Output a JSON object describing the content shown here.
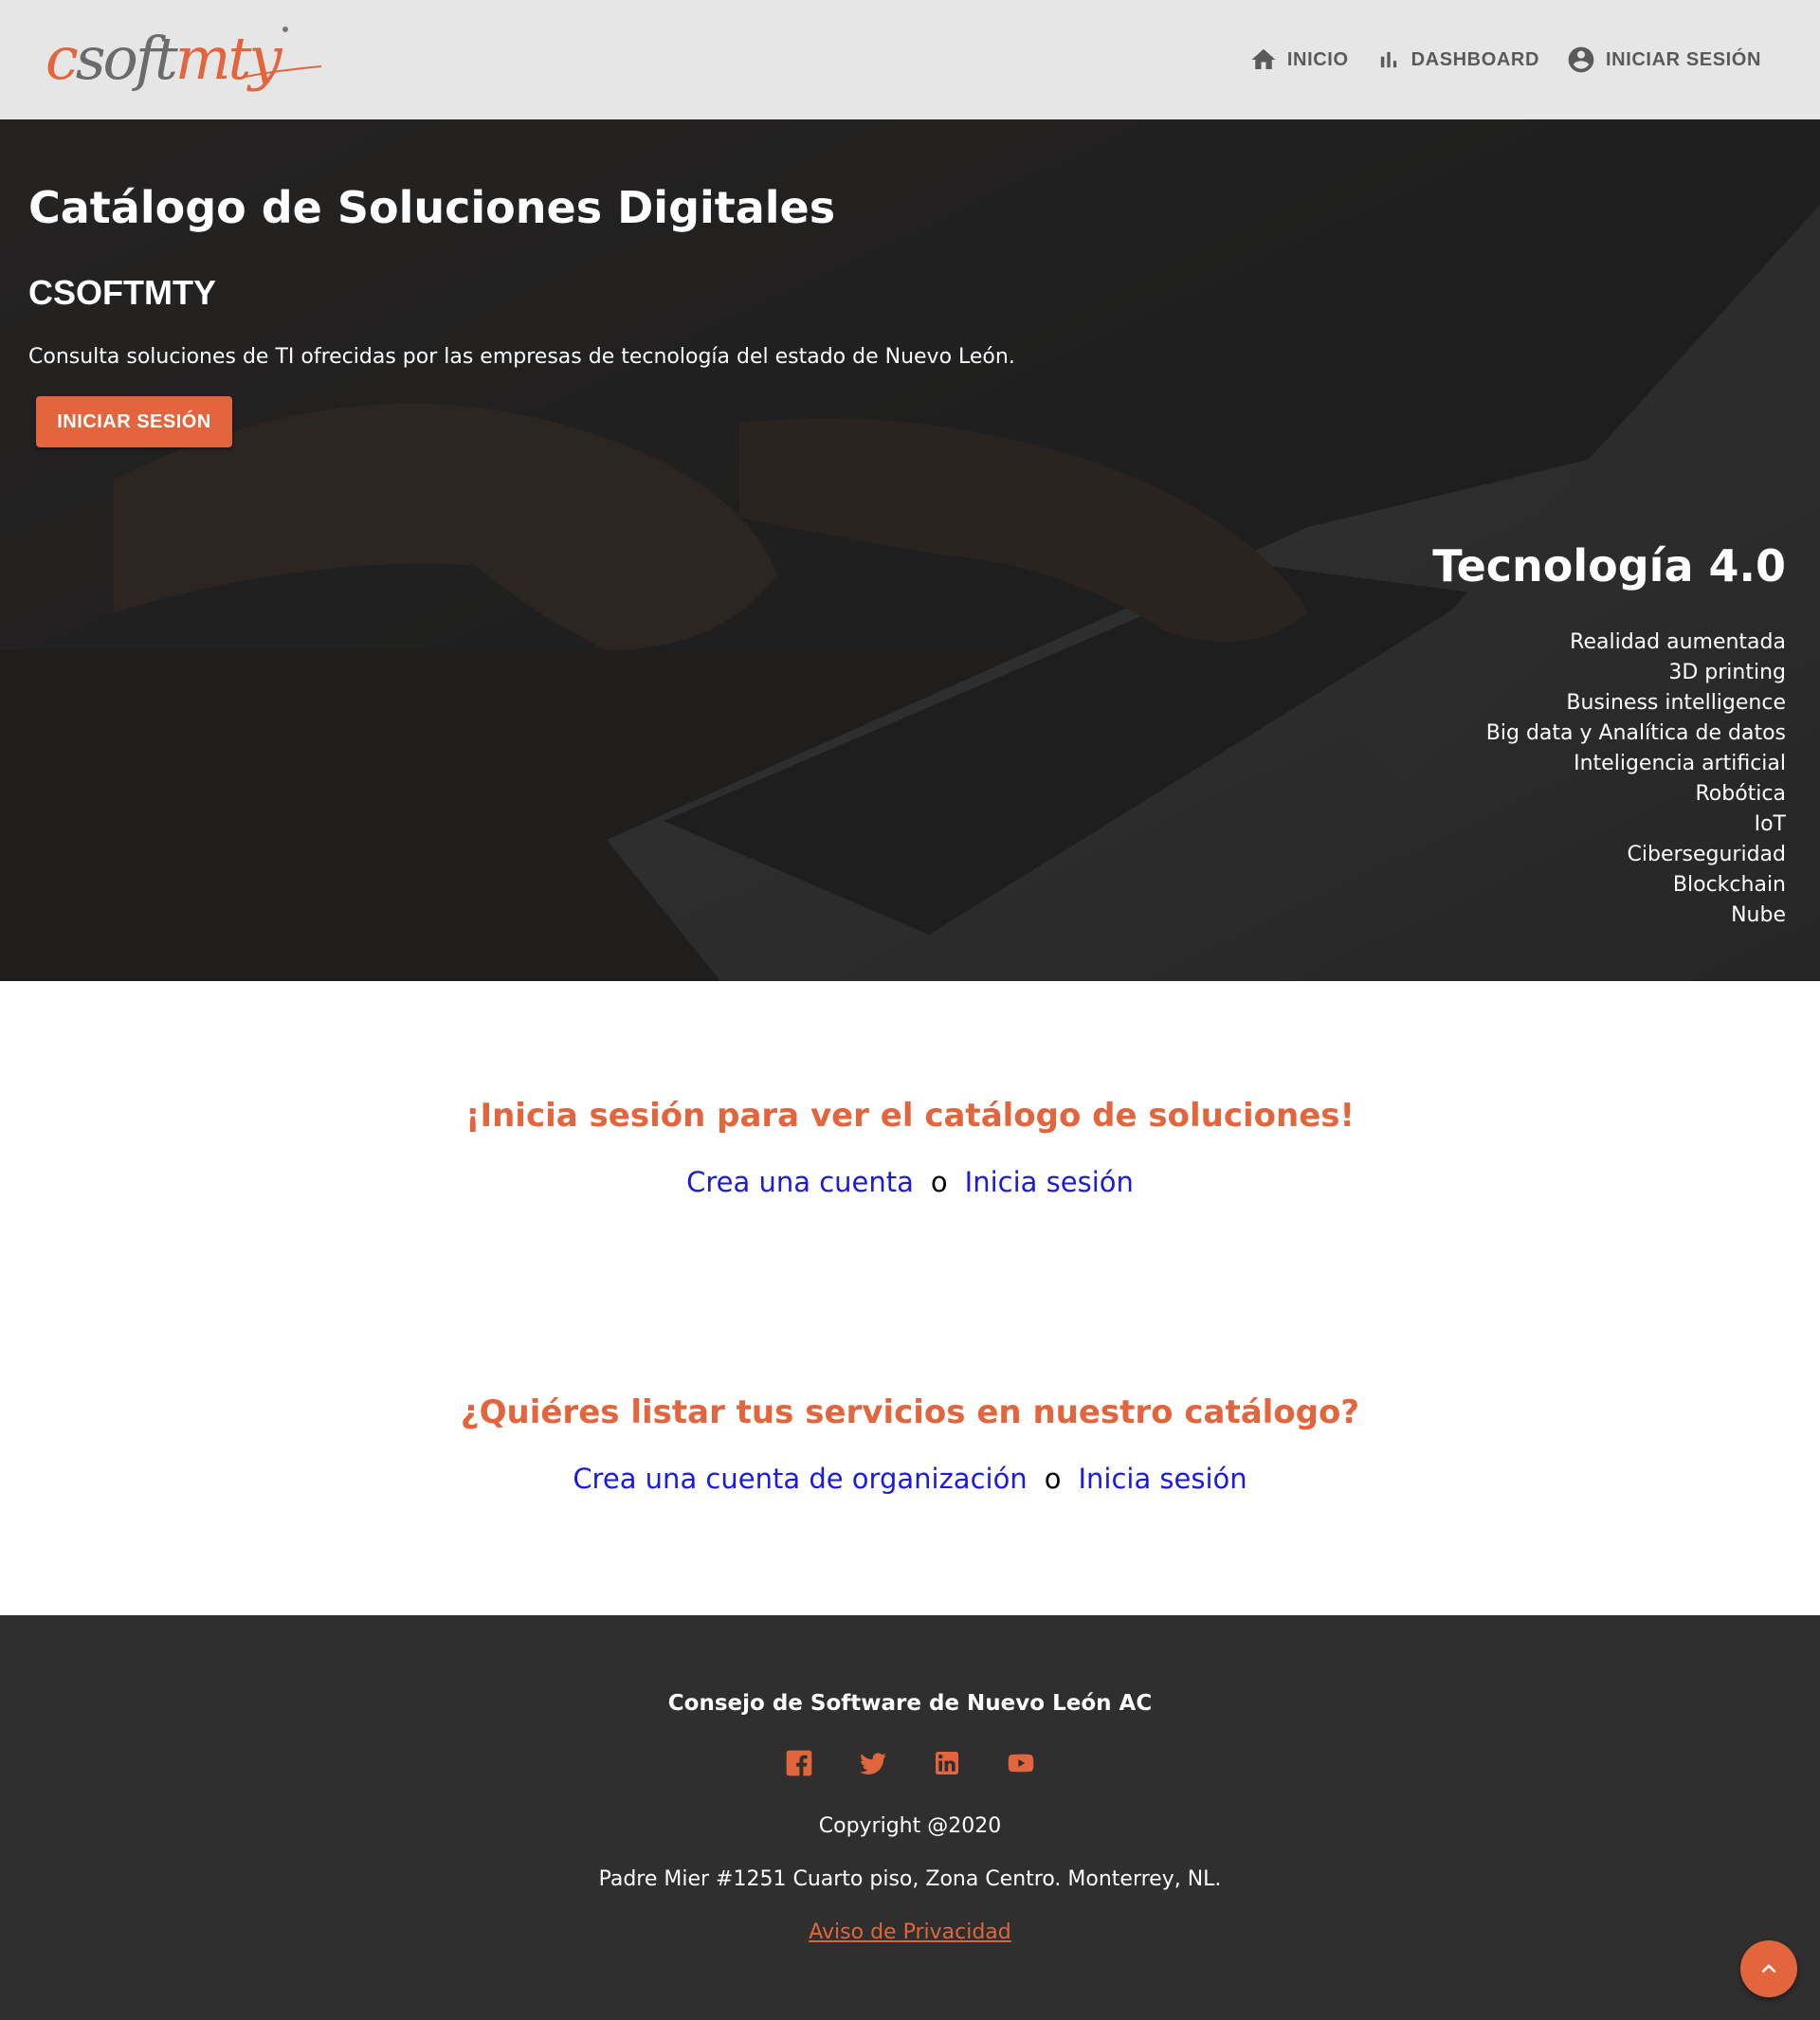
{
  "header": {
    "logo": "csoftmty",
    "nav": [
      {
        "label": "INICIO",
        "icon": "home-icon"
      },
      {
        "label": "DASHBOARD",
        "icon": "bar-chart-icon"
      },
      {
        "label": "INICIAR SESIÓN",
        "icon": "account-circle-icon"
      }
    ]
  },
  "hero": {
    "title": "Catálogo de Soluciones Digitales",
    "subtitle": "CSOFTMTY",
    "description": "Consulta soluciones de TI ofrecidas por las empresas de tecnología del estado de Nuevo León.",
    "button_label": "INICIAR SESIÓN",
    "tech_title": "Tecnología 4.0",
    "tech_items": [
      "Realidad aumentada",
      "3D printing",
      "Business intelligence",
      "Big data y Analítica de datos",
      "Inteligencia artificial",
      "Robótica",
      "IoT",
      "Ciberseguridad",
      "Blockchain",
      "Nube"
    ]
  },
  "cta_catalog": {
    "heading": "¡Inicia sesión para ver el catálogo de soluciones!",
    "link_create": "Crea una cuenta",
    "separator": "o",
    "link_login": "Inicia sesión"
  },
  "cta_services": {
    "heading": "¿Quiéres listar tus servicios en nuestro catálogo?",
    "link_create": "Crea una cuenta de organización",
    "separator": "o",
    "link_login": "Inicia sesión"
  },
  "footer": {
    "organization": "Consejo de Software de Nuevo León AC",
    "social": [
      "facebook-icon",
      "twitter-icon",
      "linkedin-icon",
      "youtube-icon"
    ],
    "copyright": "Copyright @2020",
    "address": "Padre Mier #1251 Cuarto piso, Zona Centro. Monterrey, NL.",
    "privacy_link": "Aviso de Privacidad"
  },
  "colors": {
    "accent": "#e2653d",
    "header_bg": "#e6e6e6",
    "footer_bg": "#2f2f2f",
    "link": "#1a1ae0"
  }
}
